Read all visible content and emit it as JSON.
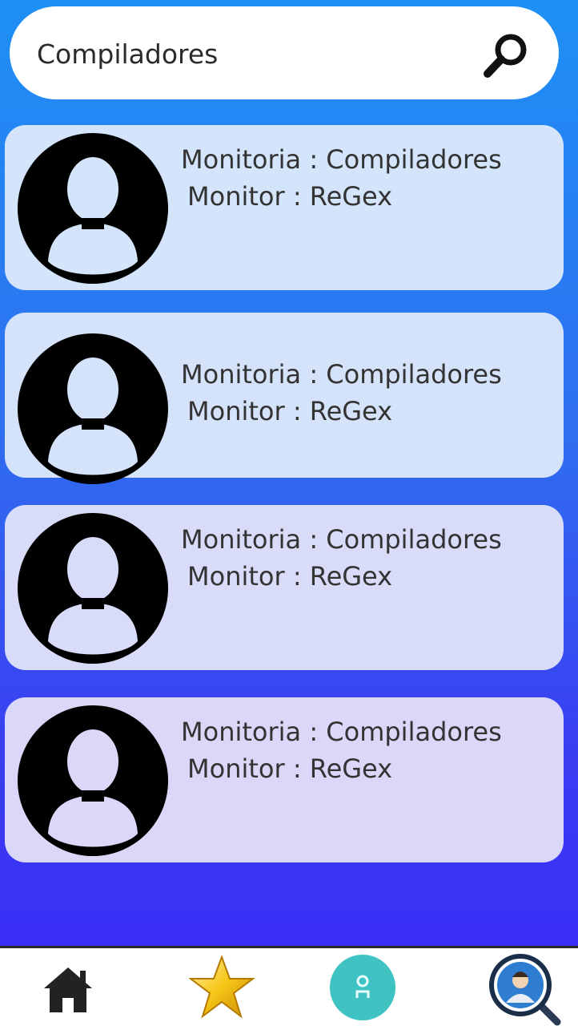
{
  "search": {
    "value": "Compiladores",
    "icon": "search-icon"
  },
  "cards": [
    {
      "line1": "Monitoria : Compiladores",
      "line2": "Monitor : ReGex",
      "icon": "avatar-icon"
    },
    {
      "line1": "Monitoria : Compiladores",
      "line2": "Monitor : ReGex",
      "icon": "avatar-icon"
    },
    {
      "line1": "Monitoria : Compiladores",
      "line2": "Monitor : ReGex",
      "icon": "avatar-icon"
    },
    {
      "line1": "Monitoria : Compiladores",
      "line2": "Monitor : ReGex",
      "icon": "avatar-icon"
    }
  ],
  "nav": {
    "items": [
      "home-icon",
      "star-icon",
      "monitor-icon",
      "search-user-icon"
    ]
  },
  "colors": {
    "gradient_top": "#1e90f5",
    "gradient_bottom": "#3a2ff6",
    "card_top": "#d6e6fb",
    "card_bottom": "#d9d6f8",
    "teal": "#3fc2c2"
  }
}
